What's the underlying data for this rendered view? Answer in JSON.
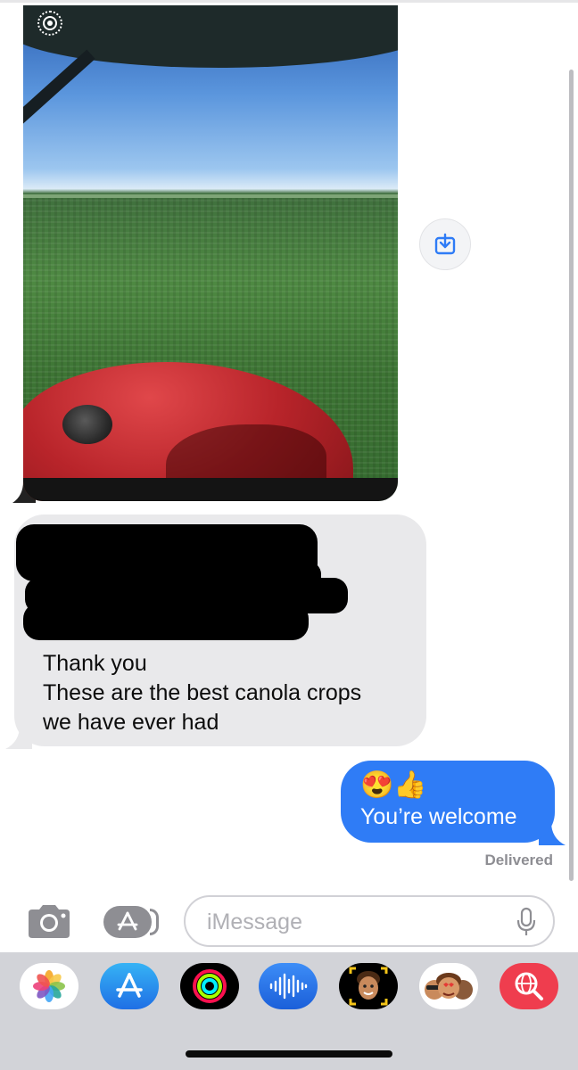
{
  "conversation": {
    "incoming": {
      "text": "Thank you\nThese are the best canola crops\nwe have ever had"
    },
    "outgoing": {
      "emoji": "😍👍",
      "text": "You’re welcome"
    },
    "status": "Delivered"
  },
  "composer": {
    "placeholder": "iMessage"
  },
  "icons": {
    "live_photo": "live-photo-icon",
    "save": "save-to-photos-icon",
    "camera": "camera-icon",
    "app_store": "app-store-icon",
    "mic": "microphone-icon"
  },
  "app_drawer": [
    {
      "name": "Photos",
      "icon": "photos-icon"
    },
    {
      "name": "App Store",
      "icon": "app-store-icon"
    },
    {
      "name": "Activity",
      "icon": "activity-icon"
    },
    {
      "name": "Audio Message",
      "icon": "audio-waveform-icon"
    },
    {
      "name": "Memoji",
      "icon": "memoji-icon"
    },
    {
      "name": "Memoji Stickers",
      "icon": "memoji-stickers-icon"
    },
    {
      "name": "Images Search",
      "icon": "globe-search-icon"
    }
  ],
  "colors": {
    "outgoing_bubble": "#2f7cf6",
    "incoming_bubble": "#e9e9eb",
    "status_text": "#8e8e93",
    "drawer_bg": "#d2d3d8"
  }
}
